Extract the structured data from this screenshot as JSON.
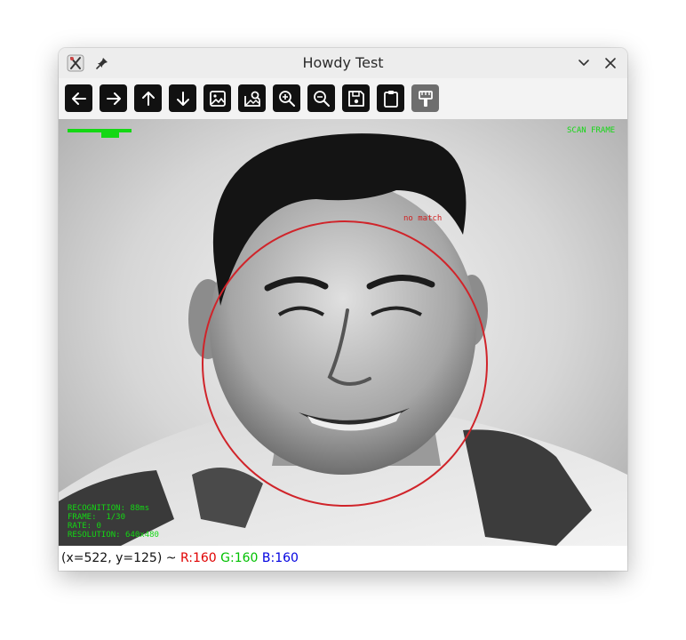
{
  "window": {
    "title": "Howdy Test"
  },
  "titlebar_icons": {
    "app": "tools-icon",
    "pin": "pin-icon",
    "minimize": "chevron-down-icon",
    "close": "close-icon"
  },
  "toolbar": {
    "buttons": [
      {
        "icon": "arrow-left-icon"
      },
      {
        "icon": "arrow-right-icon"
      },
      {
        "icon": "arrow-up-icon"
      },
      {
        "icon": "arrow-down-icon"
      },
      {
        "icon": "image-icon"
      },
      {
        "icon": "image-search-icon"
      },
      {
        "icon": "zoom-in-icon"
      },
      {
        "icon": "zoom-out-icon"
      },
      {
        "icon": "save-icon"
      },
      {
        "icon": "clipboard-icon"
      },
      {
        "icon": "paint-brush-icon"
      }
    ]
  },
  "overlay": {
    "scan_label": "SCAN FRAME",
    "match_label": "no match",
    "stats": [
      "RECOGNITION: 88ms",
      "FRAME:  1/30",
      "RATE: 0",
      "RESOLUTION: 640x480"
    ],
    "colors": {
      "overlay_text": "#14d814",
      "match_text": "#d02020",
      "face_circle": "#d0242a"
    }
  },
  "status": {
    "coords": "(x=522, y=125) ~ ",
    "r": "R:160",
    "g": "G:160",
    "b": "B:160",
    "colors": {
      "r": "#e00000",
      "g": "#00c000",
      "b": "#0000e0"
    }
  }
}
